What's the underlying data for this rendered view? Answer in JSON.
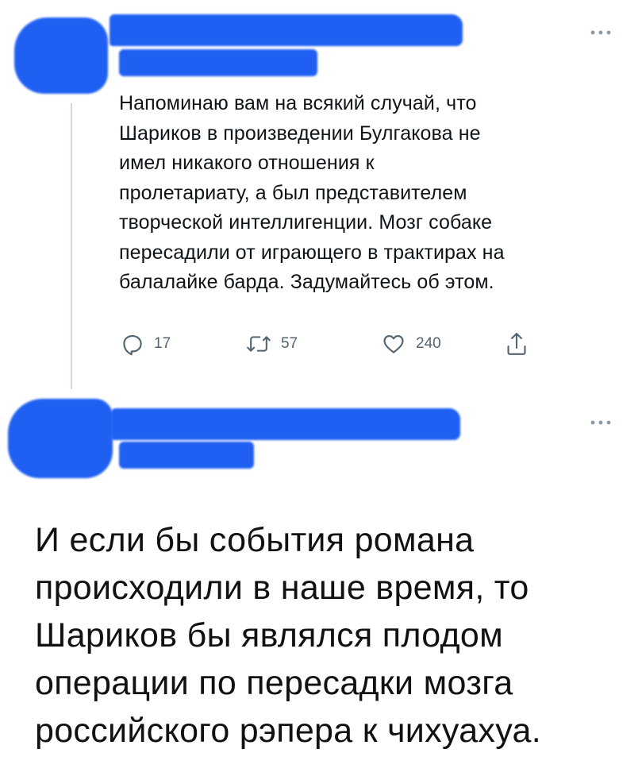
{
  "tweets": [
    {
      "text": "Напоминаю вам на всякий случай, что\nШариков в произведении Булгакова не\nимел никакого отношения к\nпролетариату, а был представителем\nтворческой интеллигенции. Мозг собаке\nпересадили от играющего в трактирах на\nбалалайке барда. Задумайтесь об этом.",
      "actions": {
        "reply_icon": "reply-icon",
        "reply_count": "17",
        "retweet_icon": "retweet-icon",
        "retweet_count": "57",
        "like_icon": "heart-icon",
        "like_count": "240",
        "share_icon": "share-icon"
      },
      "more_icon": "more-icon"
    },
    {
      "more_icon": "more-icon"
    }
  ],
  "caption": "И если бы события романа\nпроисходили в наше время, то\nШариков бы являлся плодом\nоперации по пересадки мозга\nроссийского рэпера к чихуахуа.",
  "colors": {
    "redaction": "#1f5ff2",
    "icon_gray": "#536471",
    "thread_line": "#cfd9de",
    "text": "#0f1419"
  }
}
